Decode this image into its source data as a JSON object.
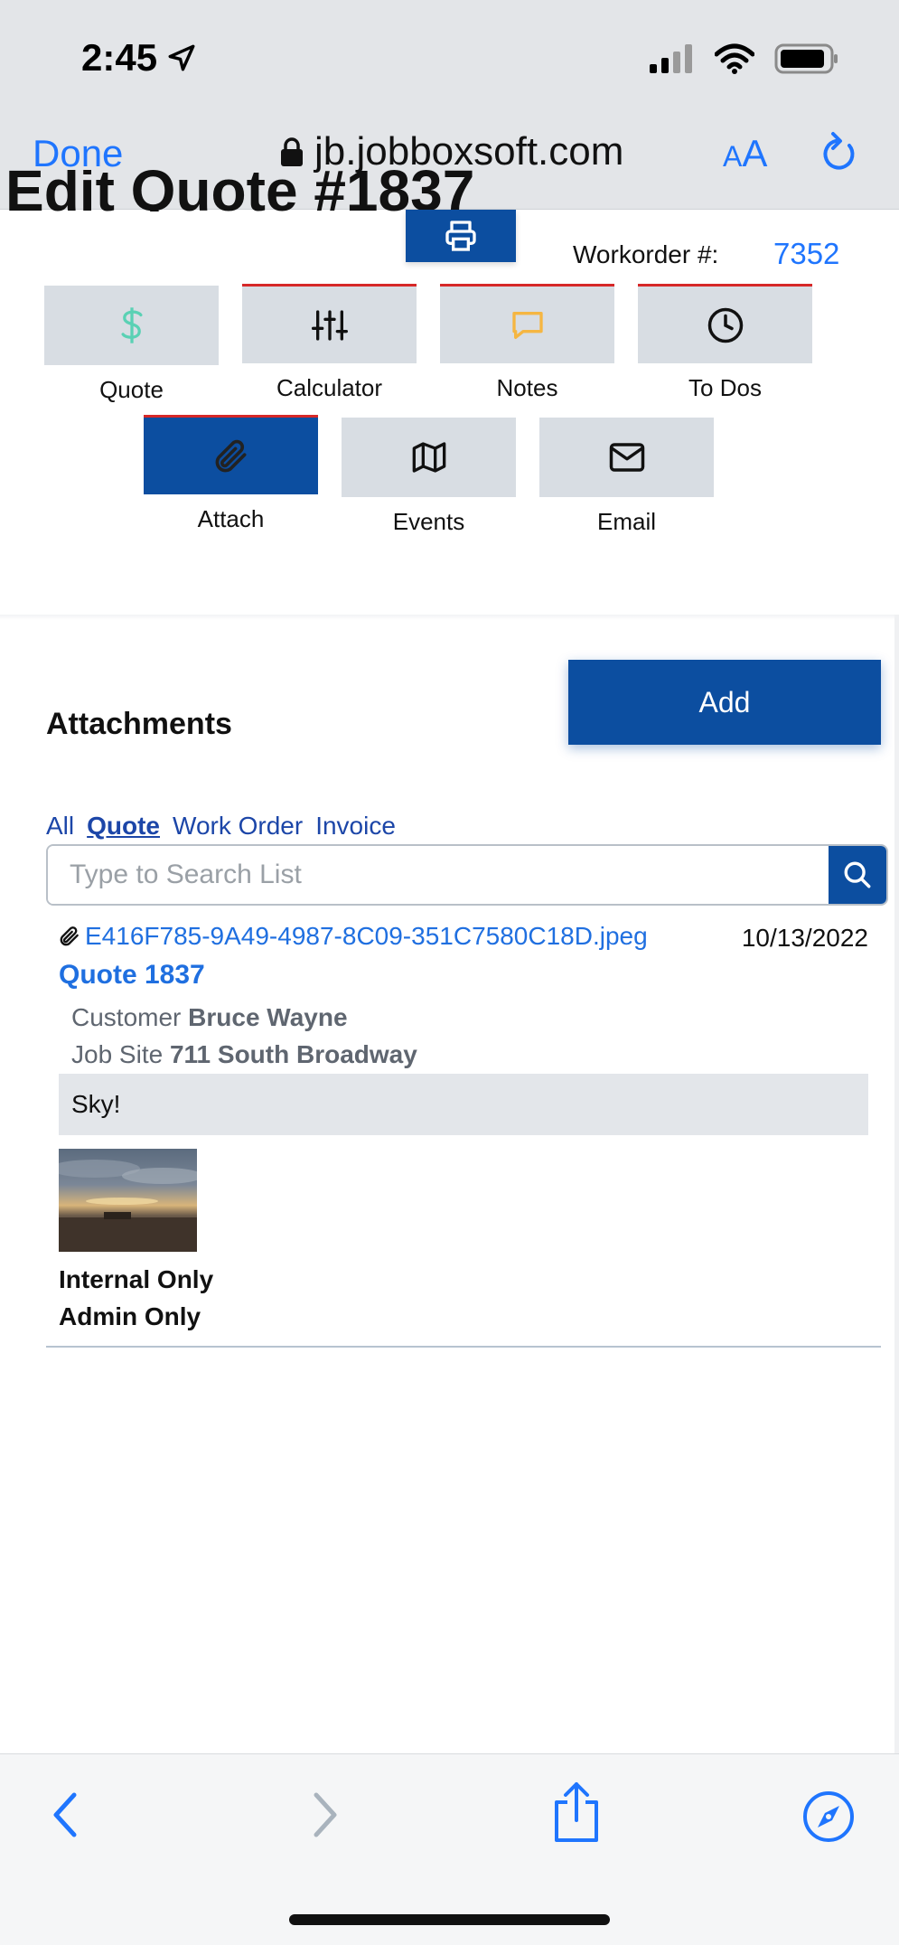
{
  "status_bar": {
    "time": "2:45"
  },
  "browser": {
    "done_label": "Done",
    "url": "jb.jobboxsoft.com",
    "text_size_small": "A",
    "text_size_large": "A"
  },
  "header": {
    "title": "Edit Quote #1837",
    "workorder_label": "Workorder #:",
    "workorder_value": "7352"
  },
  "nav_tiles": [
    {
      "label": "Quote",
      "icon": "dollar-icon",
      "color": "#5ad1b4"
    },
    {
      "label": "Calculator",
      "icon": "sliders-icon"
    },
    {
      "label": "Notes",
      "icon": "chat-icon",
      "color": "#f5b642"
    },
    {
      "label": "To Dos",
      "icon": "clock-icon"
    },
    {
      "label": "Attach",
      "icon": "paperclip-icon",
      "active": true
    },
    {
      "label": "Events",
      "icon": "map-icon"
    },
    {
      "label": "Email",
      "icon": "mail-icon"
    }
  ],
  "attachments": {
    "title": "Attachments",
    "add_label": "Add",
    "filters": [
      "All",
      "Quote",
      "Work Order",
      "Invoice"
    ],
    "selected_filter": "Quote",
    "search_placeholder": "Type to Search List",
    "items": [
      {
        "file_name": "E416F785-9A49-4987-8C09-351C7580C18D.jpeg",
        "date": "10/13/2022",
        "quote_ref": "Quote 1837",
        "customer_label": "Customer",
        "customer": "Bruce Wayne",
        "site_label": "Job Site",
        "site": "711 South Broadway",
        "note": "Sky!",
        "flags": [
          "Internal Only",
          "Admin Only"
        ]
      }
    ]
  },
  "colors": {
    "brand_blue": "#0c4ea0",
    "link_blue": "#1f6fe0",
    "ios_blue": "#1f75fe",
    "tile_bg": "#d8dde3",
    "alert_red": "#d62828"
  }
}
